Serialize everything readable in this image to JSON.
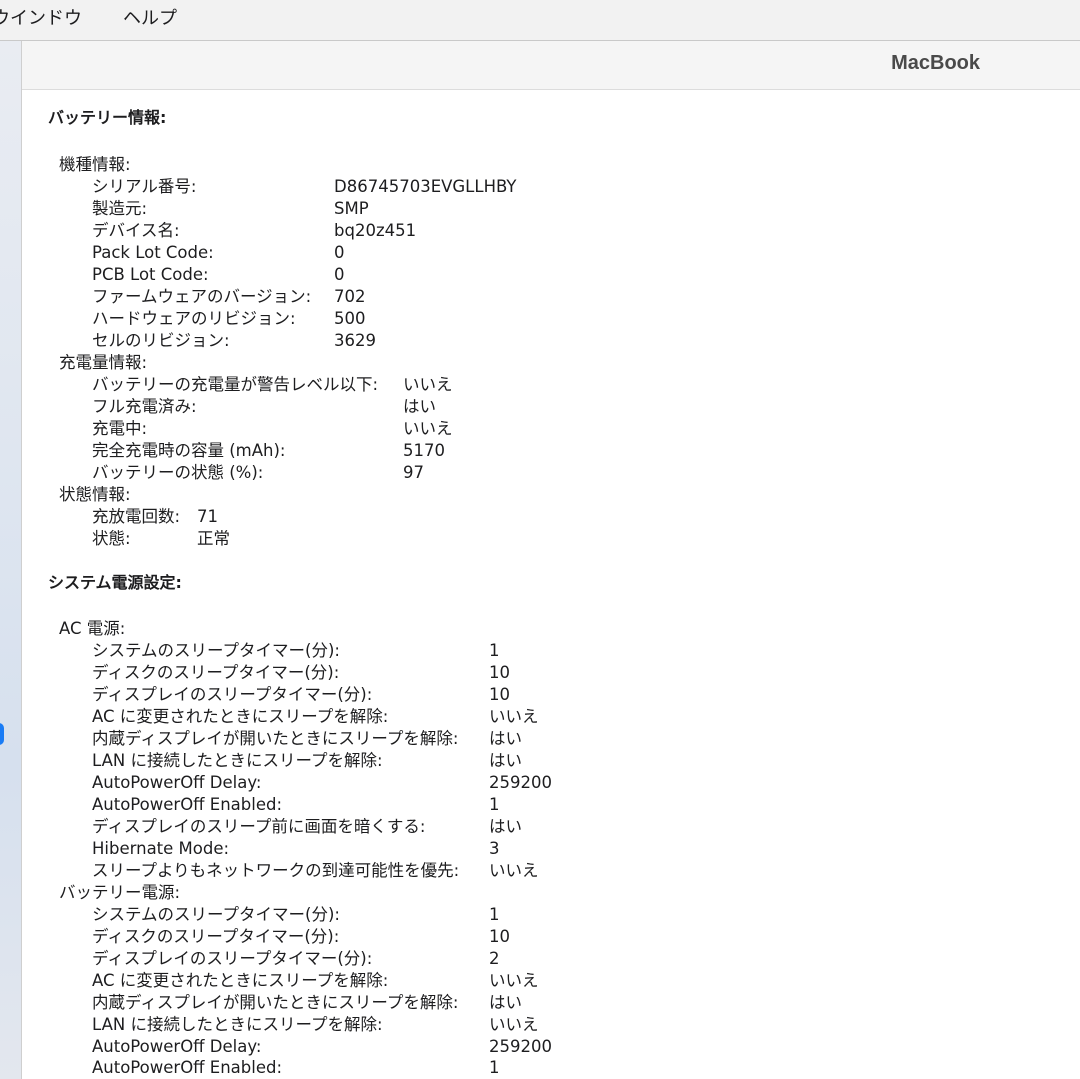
{
  "menubar": {
    "items": [
      "ウインドウ",
      "ヘルプ"
    ]
  },
  "window": {
    "title": "MacBook"
  },
  "colors": {
    "selection_accent": "#1a7cf5"
  },
  "battery": {
    "heading": "バッテリー情報:",
    "model_info": {
      "label": "機種情報:",
      "rows": [
        {
          "k": "シリアル番号:",
          "v": "D86745703EVGLLHBY"
        },
        {
          "k": "製造元:",
          "v": "SMP"
        },
        {
          "k": "デバイス名:",
          "v": "bq20z451"
        },
        {
          "k": "Pack Lot Code:",
          "v": "0"
        },
        {
          "k": "PCB Lot Code:",
          "v": "0"
        },
        {
          "k": "ファームウェアのバージョン:",
          "v": "702"
        },
        {
          "k": "ハードウェアのリビジョン:",
          "v": "500"
        },
        {
          "k": "セルのリビジョン:",
          "v": "3629"
        }
      ]
    },
    "charge_info": {
      "label": "充電量情報:",
      "rows": [
        {
          "k": "バッテリーの充電量が警告レベル以下:",
          "v": "いいえ"
        },
        {
          "k": "フル充電済み:",
          "v": "はい"
        },
        {
          "k": "充電中:",
          "v": "いいえ"
        },
        {
          "k": "完全充電時の容量 (mAh):",
          "v": "5170"
        },
        {
          "k": "バッテリーの状態 (%):",
          "v": "97"
        }
      ]
    },
    "health_info": {
      "label": "状態情報:",
      "rows": [
        {
          "k": "充放電回数:",
          "v": "71"
        },
        {
          "k": "状態:",
          "v": "正常"
        }
      ]
    }
  },
  "power": {
    "heading": "システム電源設定:",
    "ac": {
      "label": "AC 電源:",
      "rows": [
        {
          "k": "システムのスリープタイマー(分):",
          "v": "1"
        },
        {
          "k": "ディスクのスリープタイマー(分):",
          "v": "10"
        },
        {
          "k": "ディスプレイのスリープタイマー(分):",
          "v": "10"
        },
        {
          "k": "AC に変更されたときにスリープを解除:",
          "v": "いいえ"
        },
        {
          "k": "内蔵ディスプレイが開いたときにスリープを解除:",
          "v": "はい"
        },
        {
          "k": "LAN に接続したときにスリープを解除:",
          "v": "はい"
        },
        {
          "k": "AutoPowerOff Delay:",
          "v": "259200"
        },
        {
          "k": "AutoPowerOff Enabled:",
          "v": "1"
        },
        {
          "k": "ディスプレイのスリープ前に画面を暗くする:",
          "v": "はい"
        },
        {
          "k": "Hibernate Mode:",
          "v": "3"
        },
        {
          "k": "スリープよりもネットワークの到達可能性を優先:",
          "v": "いいえ"
        }
      ]
    },
    "battery_power": {
      "label": "バッテリー電源:",
      "rows": [
        {
          "k": "システムのスリープタイマー(分):",
          "v": "1"
        },
        {
          "k": "ディスクのスリープタイマー(分):",
          "v": "10"
        },
        {
          "k": "ディスプレイのスリープタイマー(分):",
          "v": "2"
        },
        {
          "k": "AC に変更されたときにスリープを解除:",
          "v": "いいえ"
        },
        {
          "k": "内蔵ディスプレイが開いたときにスリープを解除:",
          "v": "はい"
        },
        {
          "k": "LAN に接続したときにスリープを解除:",
          "v": "いいえ"
        },
        {
          "k": "AutoPowerOff Delay:",
          "v": "259200"
        },
        {
          "k": "AutoPowerOff Enabled:",
          "v": "1"
        }
      ]
    }
  }
}
